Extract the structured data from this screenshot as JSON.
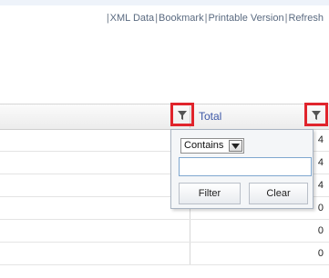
{
  "toolbar": {
    "links": [
      {
        "label": "XML Data"
      },
      {
        "label": "Bookmark"
      },
      {
        "label": "Printable Version"
      },
      {
        "label": "Refresh"
      }
    ],
    "separator": "|"
  },
  "grid": {
    "column_header": "Total",
    "rows": [
      {
        "value": "4"
      },
      {
        "value": "4"
      },
      {
        "value": "4"
      },
      {
        "value": "0"
      },
      {
        "value": "0"
      },
      {
        "value": "0"
      }
    ]
  },
  "filter_popup": {
    "operator_selected": "Contains",
    "input_value": "",
    "filter_button": "Filter",
    "clear_button": "Clear"
  },
  "icons": {
    "filter": "filter-funnel-icon",
    "dropdown": "dropdown-arrow-icon"
  },
  "colors": {
    "highlight": "#e0242c",
    "header_text": "#3c57a6"
  }
}
